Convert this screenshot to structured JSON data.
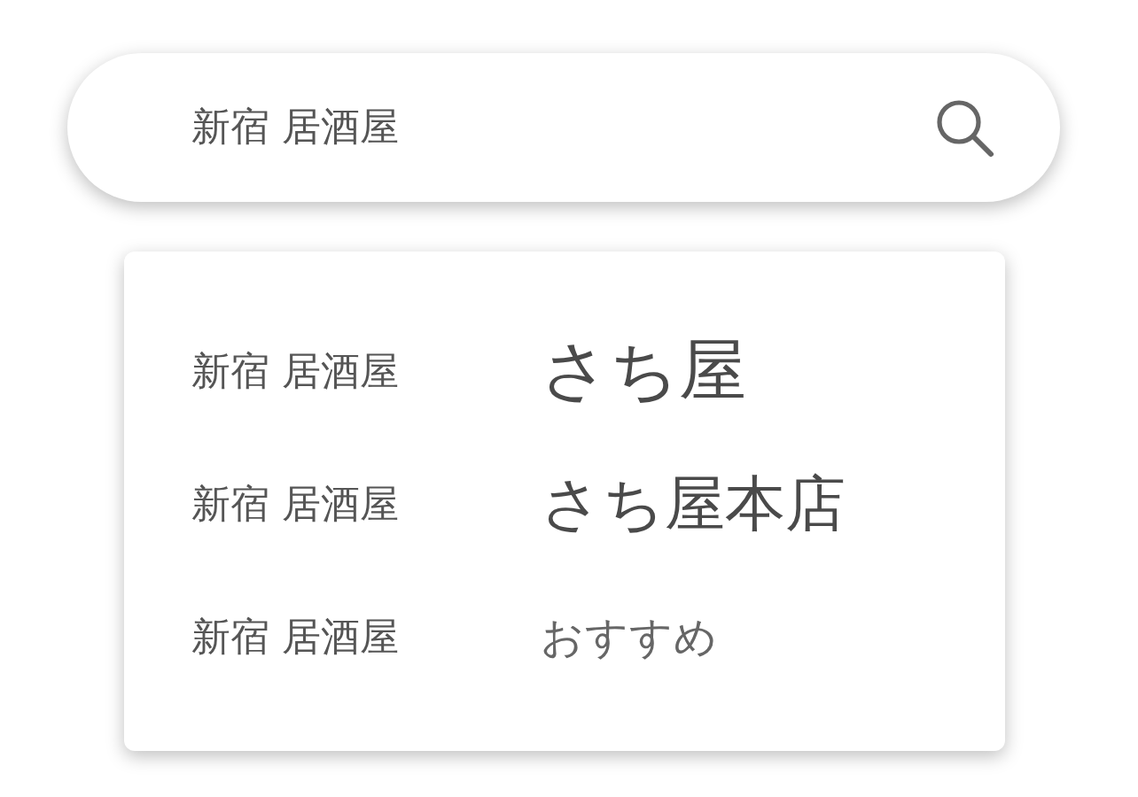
{
  "search": {
    "value": "新宿 居酒屋"
  },
  "suggestions": [
    {
      "area": "新宿 居酒屋",
      "name": "さち屋",
      "kind": "large"
    },
    {
      "area": "新宿 居酒屋",
      "name": "さち屋本店",
      "kind": "medium"
    },
    {
      "area": "新宿 居酒屋",
      "name": "おすすめ",
      "kind": "small"
    }
  ]
}
